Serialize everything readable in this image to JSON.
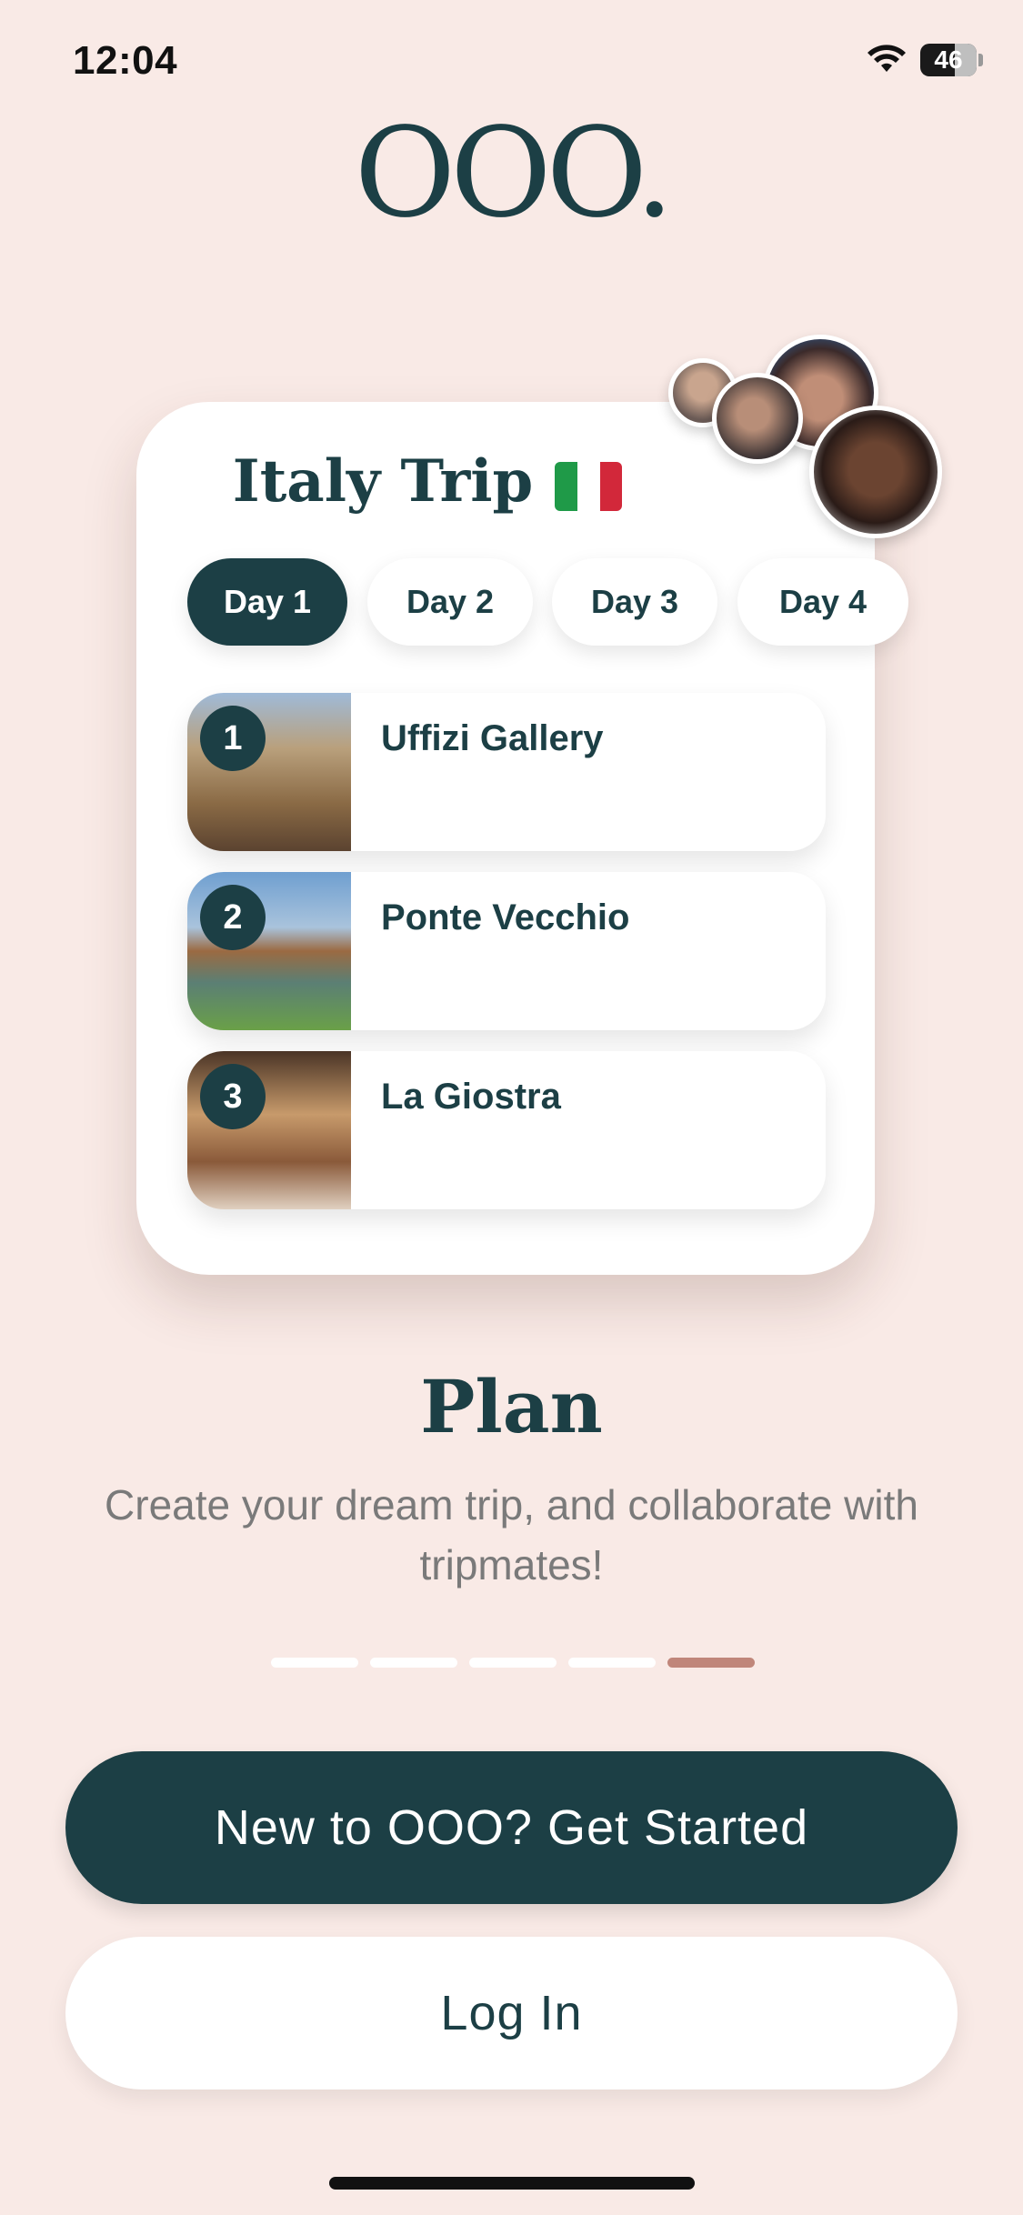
{
  "status_bar": {
    "time": "12:04",
    "battery": "46"
  },
  "app": {
    "logo": "OOO."
  },
  "card": {
    "title": "Italy Trip",
    "flag_colors": [
      "#1f9a48",
      "#ffffff",
      "#d2283a"
    ],
    "days": [
      "Day 1",
      "Day 2",
      "Day 3",
      "Day 4"
    ],
    "selected_day": "Day 1",
    "places": [
      {
        "number": "1",
        "name": "Uffizi Gallery"
      },
      {
        "number": "2",
        "name": "Ponte Vecchio"
      },
      {
        "number": "3",
        "name": "La Giostra"
      }
    ]
  },
  "feature": {
    "title": "Plan",
    "subtitle": "Create your dream trip, and collaborate with tripmates!"
  },
  "pager": {
    "total": 5,
    "active_index": 4
  },
  "buttons": {
    "get_started": "New to OOO? Get Started",
    "login": "Log In"
  },
  "colors": {
    "background": "#f9eae6",
    "primary": "#1c3f45",
    "accent": "#c0867a"
  }
}
